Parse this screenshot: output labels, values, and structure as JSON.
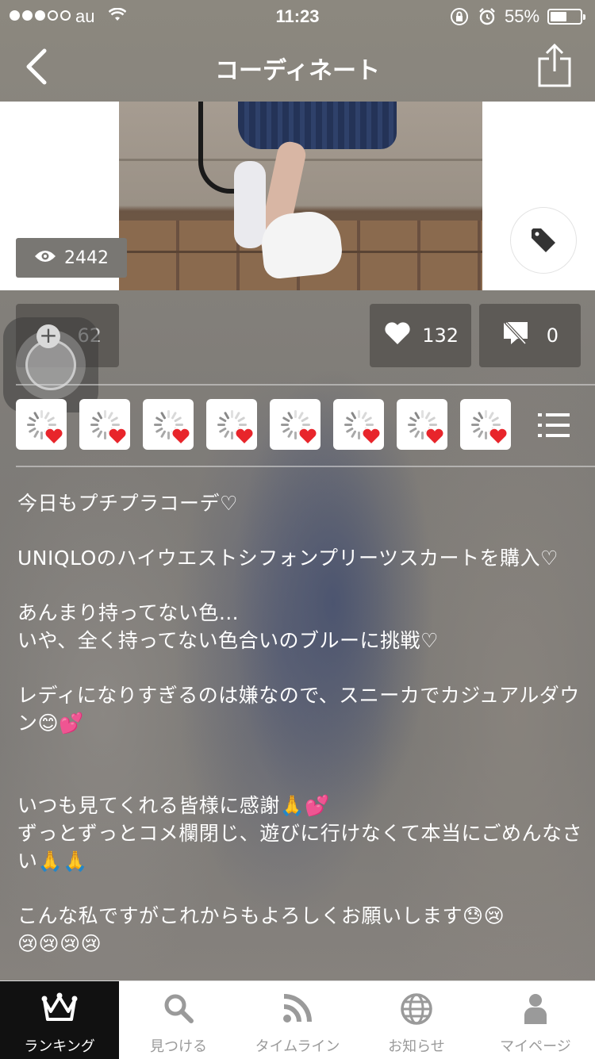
{
  "status_bar": {
    "carrier": "au",
    "time": "11:23",
    "battery_percent": "55%",
    "signal_dots_filled": 3,
    "signal_dots_total": 5,
    "battery_level": 0.55
  },
  "nav": {
    "title": "コーディネート",
    "back_icon": "chevron-left-icon",
    "share_icon": "share-icon"
  },
  "photo": {
    "view_count": "2442",
    "view_icon": "eye-icon",
    "tag_icon": "tag-icon"
  },
  "actions": {
    "add_count": "62",
    "like_count": "132",
    "comment_count": "0",
    "like_icon": "heart-icon",
    "comment_icon": "comment-disabled-icon"
  },
  "likers": {
    "count_shown": 8,
    "icon": "loading-spinner-icon",
    "badge_icon": "heart-badge-icon",
    "list_icon": "list-icon"
  },
  "post": {
    "paragraphs": [
      "今日もプチプラコーデ♡",
      "UNIQLOのハイウエストシフォンプリーツスカートを購入♡",
      "あんまり持ってない色…\nいや、全く持ってない色合いのブルーに挑戦♡",
      "レディになりすぎるのは嫌なので、スニーカでカジュアルダウン😊💕",
      "いつも見てくれる皆様に感謝🙏💕\nずっとずっとコメ欄閉じ、遊びに行けなくて本当にごめんなさい🙏🙏",
      "こんな私ですがこれからもよろしくお願いします😓😢\n😢😢😢😢"
    ]
  },
  "tabs": [
    {
      "label": "ランキング",
      "icon": "crown-icon",
      "active": true
    },
    {
      "label": "見つける",
      "icon": "search-icon",
      "active": false
    },
    {
      "label": "タイムライン",
      "icon": "rss-icon",
      "active": false
    },
    {
      "label": "お知らせ",
      "icon": "globe-icon",
      "active": false
    },
    {
      "label": "マイページ",
      "icon": "person-icon",
      "active": false
    }
  ],
  "colors": {
    "accent_heart": "#e8252b",
    "button_bg": "#5d5a56",
    "tab_active_bg": "#111111",
    "tab_inactive": "#9a9a9a"
  }
}
